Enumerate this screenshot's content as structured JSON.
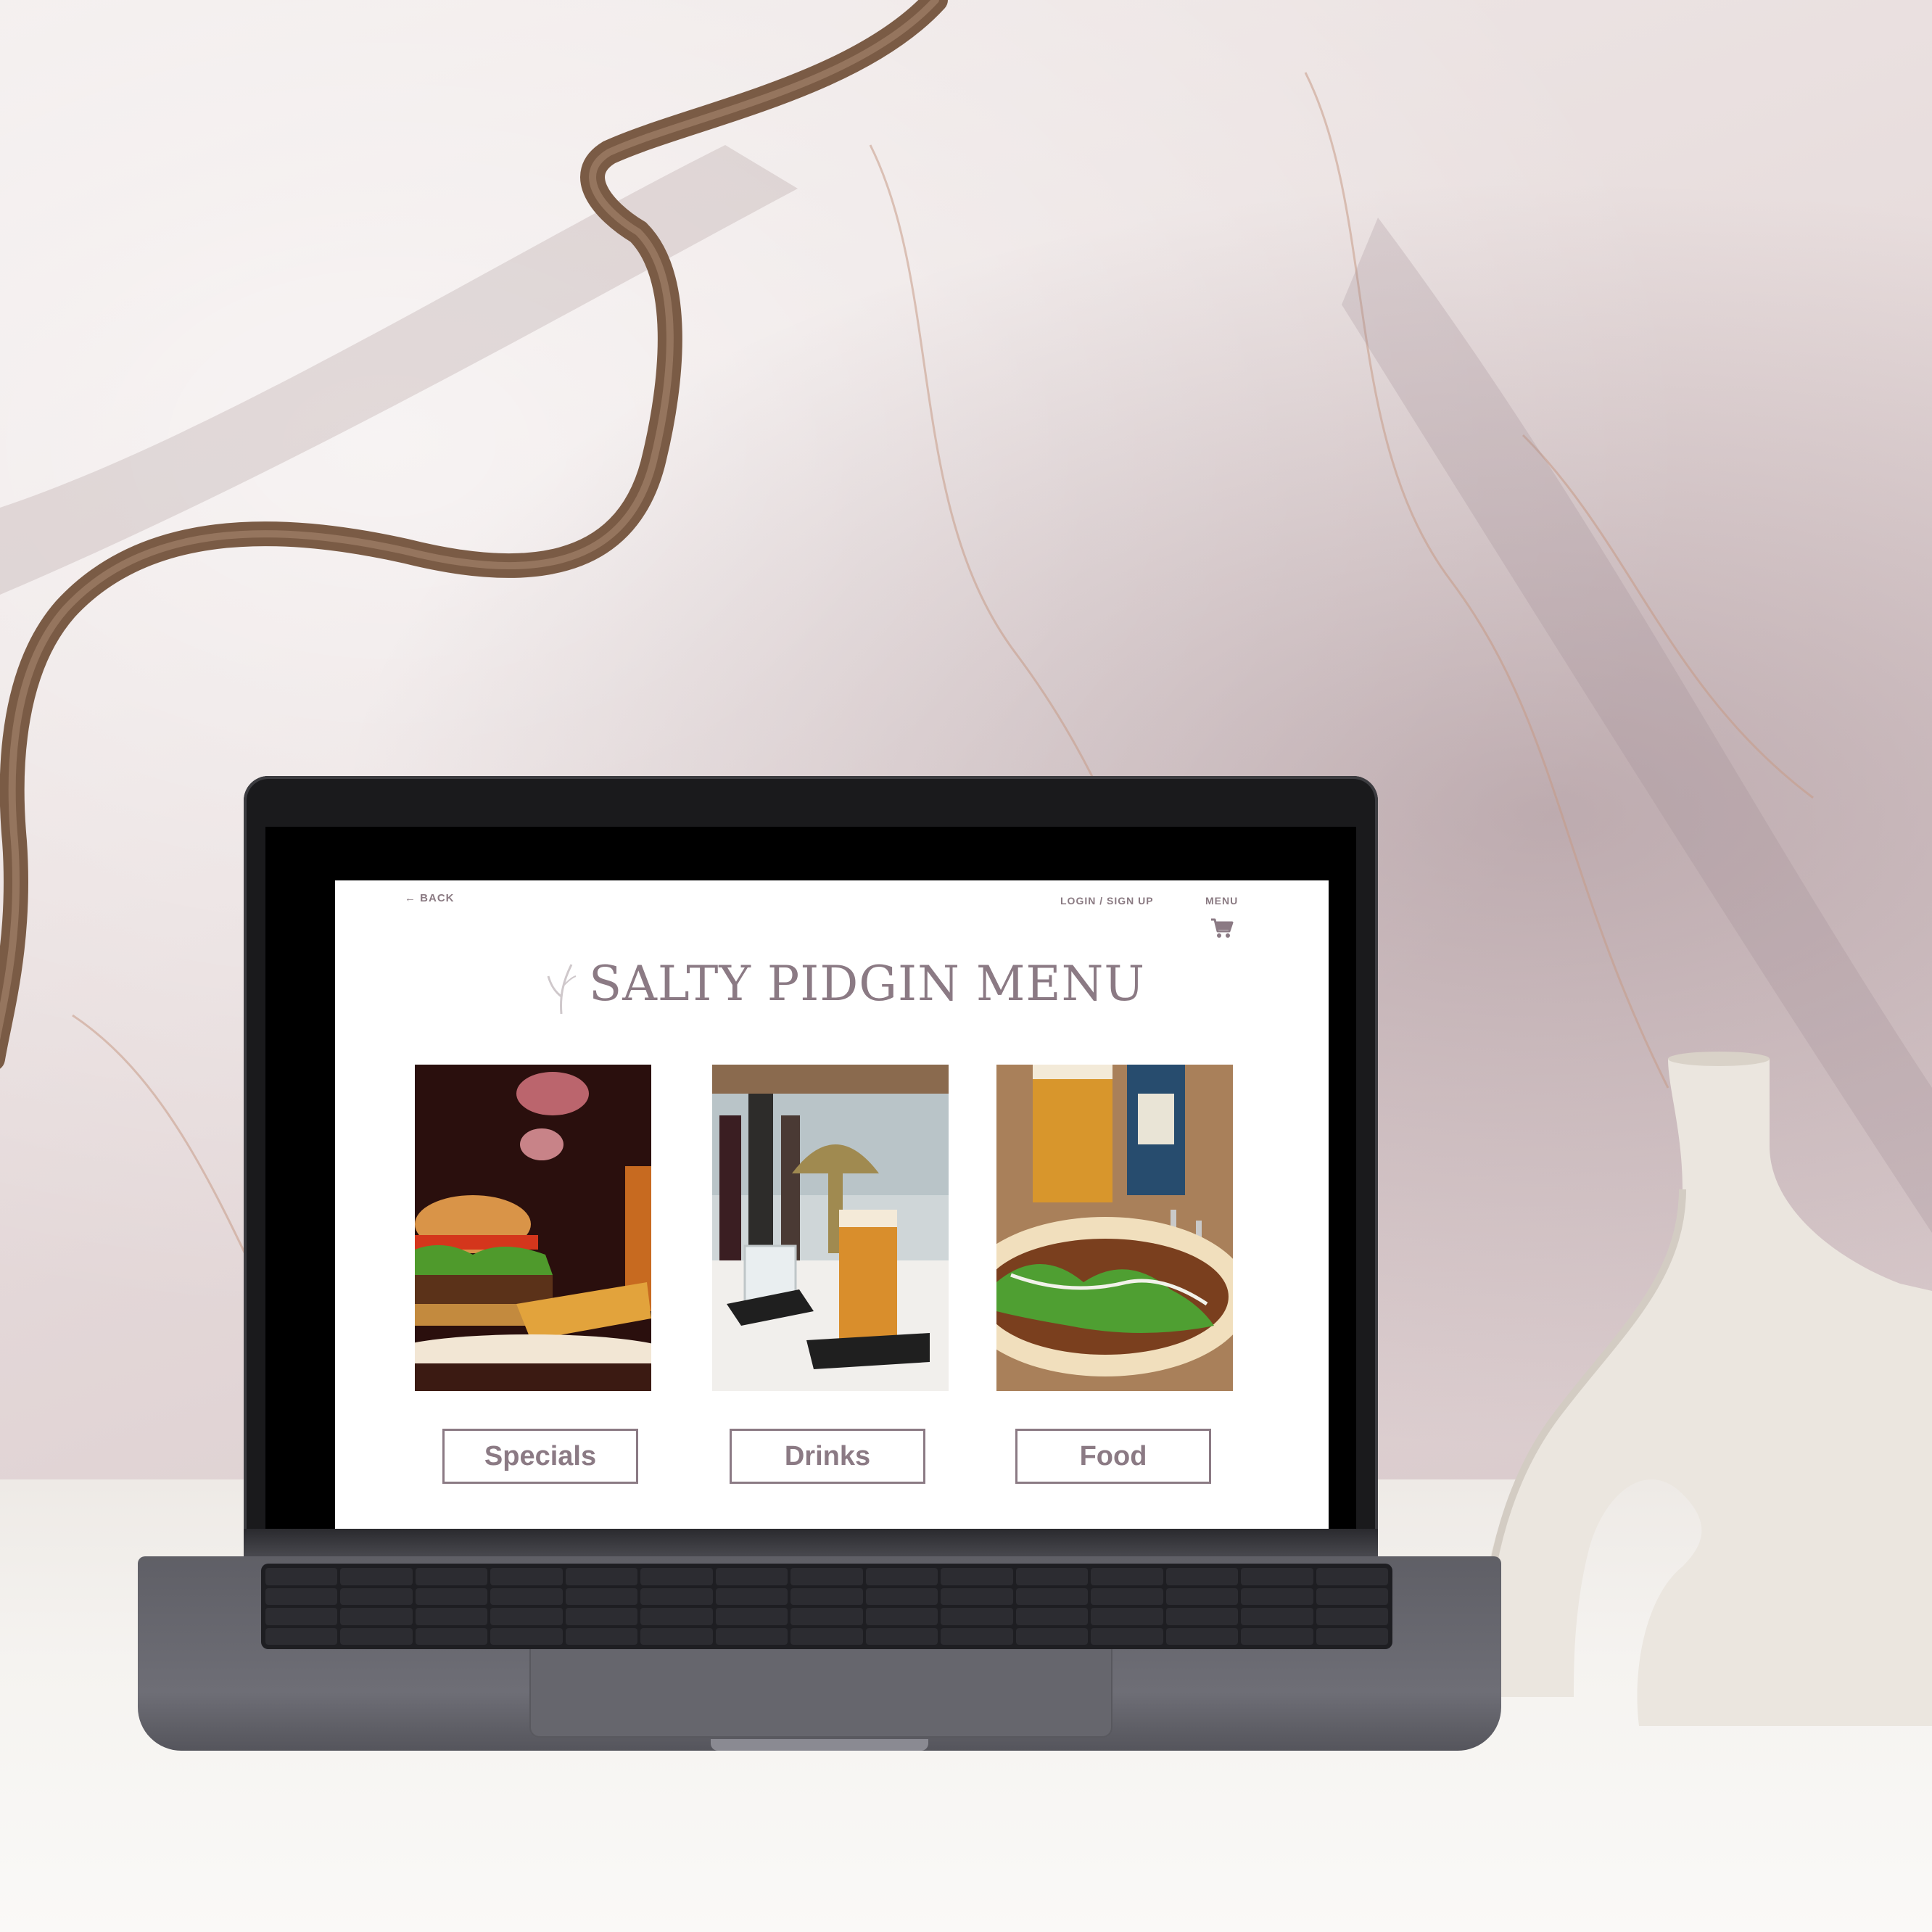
{
  "header": {
    "back_label": "← BACK",
    "login_label": "LOGIN / SIGN UP",
    "menu_label": "MENU"
  },
  "title": "SALTY PIDGIN MENU",
  "categories": [
    {
      "label": "Specials"
    },
    {
      "label": "Drinks"
    },
    {
      "label": "Food"
    }
  ],
  "colors": {
    "accent": "#8b7a84",
    "background": "#ffffff"
  },
  "icons": {
    "cart": "shopping-cart-icon",
    "logo": "plant-sprig-icon"
  }
}
